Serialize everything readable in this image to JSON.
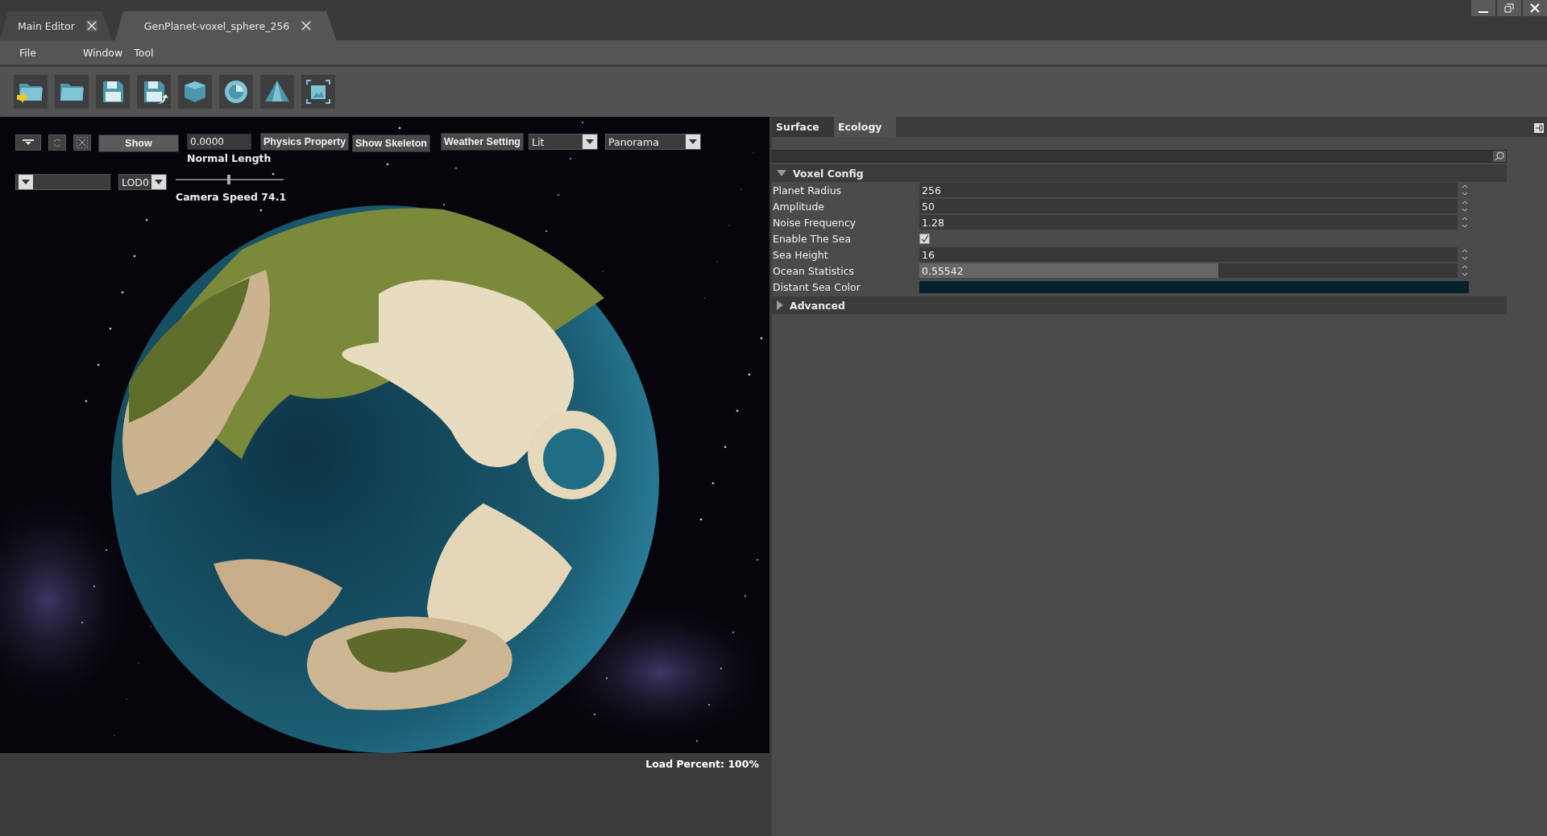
{
  "window": {
    "tabs": [
      {
        "label": "Main Editor",
        "selected": false
      },
      {
        "label": "GenPlanet-voxel_sphere_256",
        "selected": true
      }
    ]
  },
  "menu": [
    "File",
    "Window",
    "Tool"
  ],
  "viewport": {
    "show_button": "Show",
    "normal_length": {
      "value": "0.0000",
      "label": "Normal Length"
    },
    "buttons": [
      "Physics Property",
      "Show Skeleton",
      "Weather Setting"
    ],
    "dropdowns": [
      "Lit",
      "Panorama"
    ],
    "lod": "LOD0",
    "camera_speed": {
      "label": "Camera Speed 74.1",
      "level": 0.49
    },
    "load_percent": "Load Percent: 100%"
  },
  "panel": {
    "tabs": [
      {
        "label": "Surface",
        "selected": false
      },
      {
        "label": "Ecology",
        "selected": true
      }
    ],
    "sections": [
      {
        "title": "Voxel Config",
        "expanded": true,
        "rows": [
          {
            "label": "Planet Radius",
            "kind": "number",
            "value": "256"
          },
          {
            "label": "Amplitude",
            "kind": "number",
            "value": "50"
          },
          {
            "label": "Noise Frequency",
            "kind": "number",
            "value": "1.28"
          },
          {
            "label": "Enable The Sea",
            "kind": "checkbox",
            "checked": true
          },
          {
            "label": "Sea Height",
            "kind": "number",
            "value": "16"
          },
          {
            "label": "Ocean Statistics",
            "kind": "slider",
            "value": "0.55542",
            "level": 0.555
          },
          {
            "label": "Distant Sea Color",
            "kind": "color",
            "color": "#03222b"
          }
        ]
      },
      {
        "title": "Advanced",
        "expanded": false
      }
    ]
  }
}
